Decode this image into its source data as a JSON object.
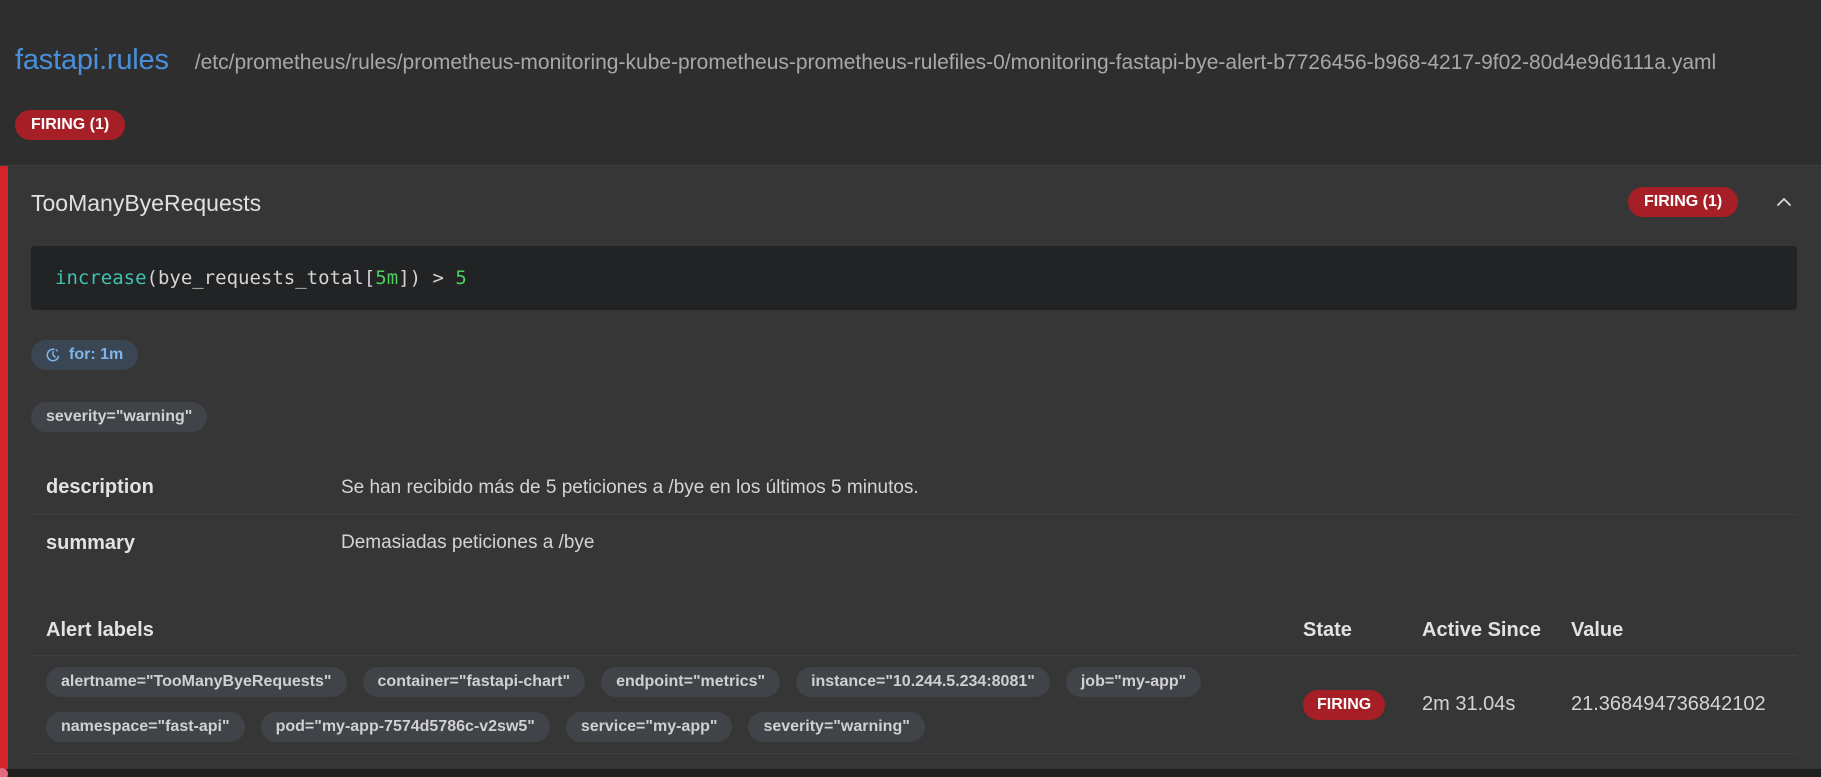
{
  "group": {
    "name": "fastapi.rules",
    "file": "/etc/prometheus/rules/prometheus-monitoring-kube-prometheus-prometheus-rulefiles-0/monitoring-fastapi-bye-alert-b7726456-b968-4217-9f02-80d4e9d6111a.yaml",
    "badge": "FIRING (1)"
  },
  "rule": {
    "name": "TooManyByeRequests",
    "badge": "FIRING (1)",
    "collapse_icon": "chevron-up-icon",
    "query": {
      "fn": "increase",
      "open": "(bye_requests_total[",
      "range": "5m",
      "close": "]) > ",
      "threshold": "5"
    },
    "for_icon": "clock-icon",
    "for_label": "for: 1m",
    "labels": [
      "severity=\"warning\""
    ],
    "annotations": {
      "description_key": "description",
      "description_value": "Se han recibido más de 5 peticiones a /bye en los últimos 5 minutos.",
      "summary_key": "summary",
      "summary_value": "Demasiadas peticiones a /bye"
    }
  },
  "alerts_table": {
    "headers": {
      "labels": "Alert labels",
      "state": "State",
      "active_since": "Active Since",
      "value": "Value"
    },
    "rows": [
      {
        "labels": [
          "alertname=\"TooManyByeRequests\"",
          "container=\"fastapi-chart\"",
          "endpoint=\"metrics\"",
          "instance=\"10.244.5.234:8081\"",
          "job=\"my-app\"",
          "namespace=\"fast-api\"",
          "pod=\"my-app-7574d5786c-v2sw5\"",
          "service=\"my-app\"",
          "severity=\"warning\""
        ],
        "state": "FIRING",
        "active_since": "2m 31.04s",
        "value": "21.368494736842102"
      }
    ]
  },
  "colors": {
    "background": "#2e2e2e",
    "card": "#363636",
    "firing": "#a61f26",
    "accent_bar": "#d4232b",
    "group_name": "#4b8fdb"
  }
}
